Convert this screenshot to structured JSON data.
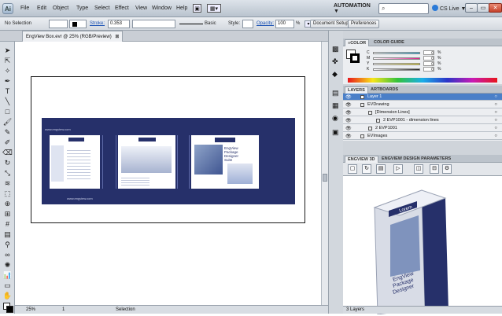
{
  "app": {
    "logo_text": "Ai",
    "menus": [
      "File",
      "Edit",
      "Object",
      "Type",
      "Select",
      "Effect",
      "View",
      "Window",
      "Help"
    ],
    "workspace": "AUTOMATION ▼",
    "cslive": "CS Live ▼"
  },
  "control_bar": {
    "selection": "No Selection",
    "stroke_label": "Stroke:",
    "stroke_value": "0.353",
    "brush_label": "Basic",
    "style_label": "Style:",
    "opacity_label": "Opacity:",
    "opacity_value": "100",
    "percent": "%",
    "document_setup": "Document Setup",
    "preferences": "Preferences"
  },
  "document_tab": {
    "label": "EngView Box.evr @ 25% (RGB/Preview)",
    "close": "⊠"
  },
  "status_bar": {
    "zoom": "25%",
    "page": "1",
    "mode": "Selection"
  },
  "color_panel": {
    "tabs": [
      "≡COLOR",
      "COLOR GUIDE"
    ],
    "channels": [
      {
        "label": "C",
        "value": "0",
        "unit": "%",
        "color": "#18a8d8"
      },
      {
        "label": "M",
        "value": "0",
        "unit": "%",
        "color": "#d8208a"
      },
      {
        "label": "Y",
        "value": "0",
        "unit": "%",
        "color": "#e8d820"
      },
      {
        "label": "K",
        "value": "0",
        "unit": "%",
        "color": "#222222"
      }
    ]
  },
  "layers_panel": {
    "tabs": [
      "LAYERS",
      "ARTBOARDS"
    ],
    "rows": [
      {
        "name": "Layer 1",
        "indent": 0,
        "selected": true
      },
      {
        "name": "EVDrawing",
        "indent": 0,
        "selected": false
      },
      {
        "name": "[Dimension Lines]",
        "indent": 1,
        "selected": false
      },
      {
        "name": "2 EVP1001 - dimension lines",
        "indent": 2,
        "selected": false
      },
      {
        "name": "2 EVP1001",
        "indent": 1,
        "selected": false
      },
      {
        "name": "EVImages",
        "indent": 0,
        "selected": false
      }
    ],
    "footer": "3 Layers"
  },
  "engview_panel": {
    "tabs": [
      "ENGVIEW 3D",
      "ENGVIEW DESIGN PARAMETERS"
    ],
    "tool_icons": [
      "view-front-icon",
      "view-rotate-icon",
      "view-unfold-icon",
      "view-play-icon",
      "view-fit-icon",
      "view-fold-icon",
      "view-settings-icon"
    ]
  },
  "box_art": {
    "brand": "Lorem",
    "cover_title_1": "EngView",
    "cover_title_2": "Package",
    "cover_title_3": "Designer",
    "cover_title_4": "Suite",
    "url": "www.engview.com"
  },
  "colors": {
    "accent_blue": "#26306a",
    "selection_blue": "#4a7fc8",
    "close_red": "#c5412a"
  }
}
